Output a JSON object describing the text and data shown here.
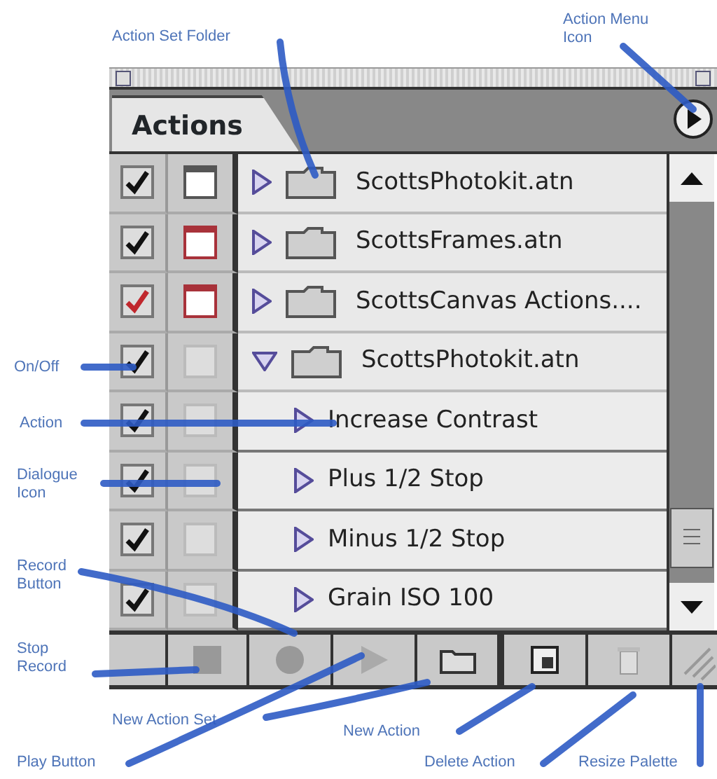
{
  "palette": {
    "tab": "Actions",
    "rows": [
      {
        "kind": "set",
        "label": "ScottsPhotokit.atn",
        "checked": true,
        "color": "#111111",
        "dialog": {
          "on": true,
          "color": "#555555"
        },
        "expanded": false
      },
      {
        "kind": "set",
        "label": "ScottsFrames.atn",
        "checked": true,
        "color": "#111111",
        "dialog": {
          "on": true,
          "color": "#a8323a"
        },
        "expanded": false
      },
      {
        "kind": "set",
        "label": "ScottsCanvas Actions....",
        "checked": true,
        "color": "#c0272d",
        "dialog": {
          "on": true,
          "color": "#a8323a"
        },
        "expanded": false
      },
      {
        "kind": "set",
        "label": "ScottsPhotokit.atn",
        "checked": true,
        "color": "#111111",
        "dialog": {
          "on": false
        },
        "expanded": true
      },
      {
        "kind": "action",
        "label": "Increase Contrast",
        "checked": true,
        "color": "#111111",
        "dialog": {
          "on": false
        }
      },
      {
        "kind": "action",
        "label": "Plus 1/2 Stop",
        "checked": true,
        "color": "#111111",
        "dialog": {
          "on": false
        }
      },
      {
        "kind": "action",
        "label": "Minus 1/2 Stop",
        "checked": true,
        "color": "#111111",
        "dialog": {
          "on": false
        }
      },
      {
        "kind": "action",
        "label": "Grain ISO 100",
        "checked": true,
        "color": "#111111",
        "dialog": {
          "on": false
        }
      }
    ]
  },
  "callouts": [
    {
      "text": "Action Set Folder"
    },
    {
      "text": "Action Menu Icon"
    },
    {
      "text": "On/Off"
    },
    {
      "text": "Action"
    },
    {
      "text": "Dialogue Icon"
    },
    {
      "text": "Record Button"
    },
    {
      "text": "Stop Record"
    },
    {
      "text": "New Action Set"
    },
    {
      "text": "Play Button"
    },
    {
      "text": "New Action"
    },
    {
      "text": "Delete Action"
    },
    {
      "text": "Resize Palette"
    }
  ]
}
